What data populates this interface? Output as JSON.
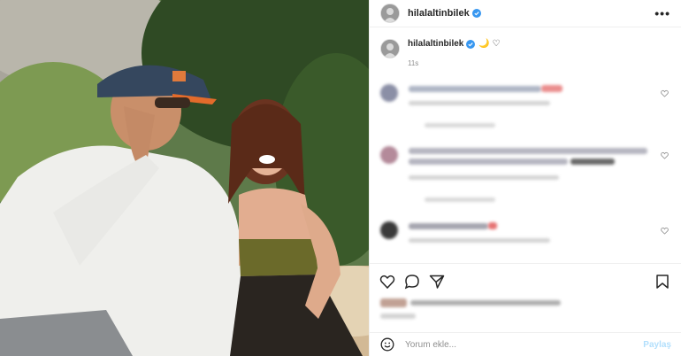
{
  "post": {
    "username": "hilalaltinbilek",
    "caption_emojis": "🌙 ♡",
    "time_ago": "11s",
    "more_label": "•••"
  },
  "comment_box": {
    "placeholder": "Yorum ekle...",
    "share_label": "Paylaş"
  },
  "icons": {
    "verified": "verified-badge",
    "more": "more-icon",
    "like": "heart-icon",
    "comment": "comment-icon",
    "share": "share-icon",
    "save": "bookmark-icon",
    "emoji": "smiley-icon"
  },
  "colors": {
    "verified_blue": "#3897f0",
    "share_disabled": "#b2dffc",
    "divider": "#efefef"
  }
}
